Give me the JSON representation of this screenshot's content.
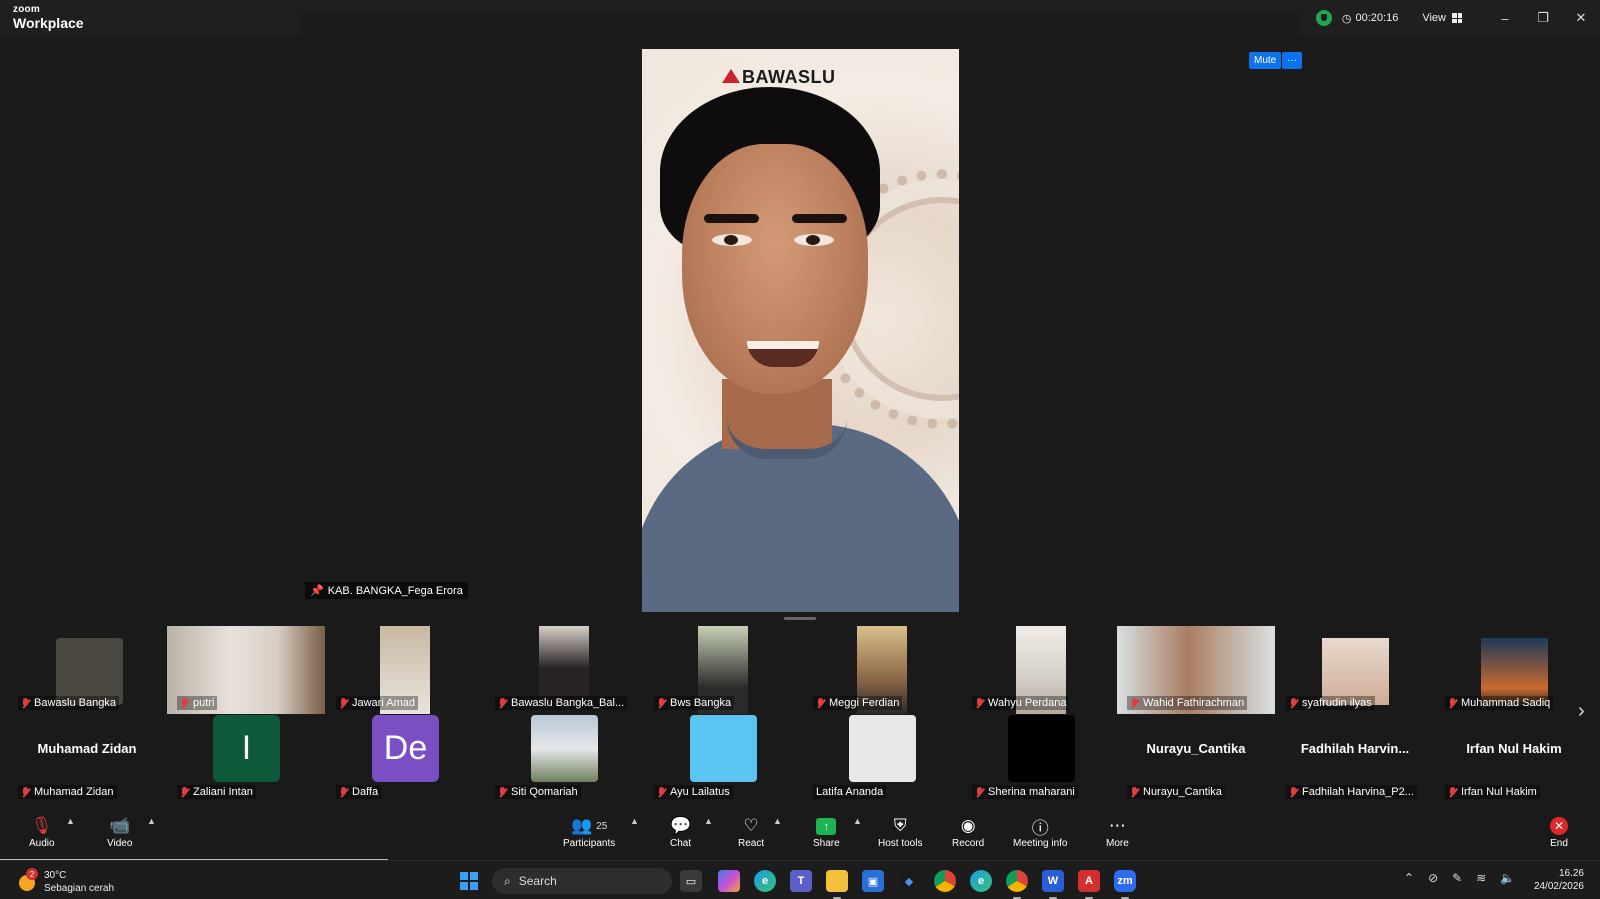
{
  "app": {
    "brand_top": "zoom",
    "brand_bottom": "Workplace"
  },
  "titlebar": {
    "timer": "00:20:16",
    "view_label": "View",
    "minimize": "–",
    "restore": "❐",
    "close": "✕"
  },
  "main": {
    "speaker_name": "KAB. BANGKA_Fega Erora",
    "banner_text": "BAWASLU",
    "mute_label": "Mute",
    "more_label": "···"
  },
  "gallery": {
    "row1": [
      {
        "name": "Bawaslu Bangka"
      },
      {
        "name": "putri"
      },
      {
        "name": "Jawari Amad"
      },
      {
        "name": "Bawaslu Bangka_Bal..."
      },
      {
        "name": "Bws Bangka"
      },
      {
        "name": "Meggi Ferdian"
      },
      {
        "name": "Wahyu Perdana"
      },
      {
        "name": "Wahid Fathirachman"
      },
      {
        "name": "syafrudin ilyas"
      },
      {
        "name": "Muhammad Sadiq"
      }
    ],
    "row2": [
      {
        "name": "Muhamad Zidan",
        "display": "Muhamad Zidan"
      },
      {
        "name": "Zaliani Intan",
        "avatar": "I"
      },
      {
        "name": "Daffa",
        "avatar": "De"
      },
      {
        "name": "Siti Qomariah"
      },
      {
        "name": "Ayu Lailatus"
      },
      {
        "name": "Latifa Ananda"
      },
      {
        "name": "Sherina maharani"
      },
      {
        "name": "Nurayu_Cantika",
        "display": "Nurayu_Cantika"
      },
      {
        "name": "Fadhilah Harvina_P2...",
        "display": "Fadhilah  Harvin..."
      },
      {
        "name": "Irfan Nul Hakim",
        "display": "Irfan Nul Hakim"
      }
    ],
    "next_arrow": "›"
  },
  "toolbar": {
    "audio": "Audio",
    "video": "Video",
    "participants": "Participants",
    "participants_count": "25",
    "chat": "Chat",
    "react": "React",
    "share": "Share",
    "host_tools": "Host tools",
    "record": "Record",
    "meeting_info": "Meeting info",
    "more": "More",
    "end": "End"
  },
  "taskbar": {
    "weather_temp": "30°C",
    "weather_desc": "Sebagian cerah",
    "weather_badge": "2",
    "search_placeholder": "Search",
    "time": "16.26",
    "date": "24/02/2026"
  },
  "colors": {
    "accent_blue": "#0e72ed",
    "share_green": "#1cb351",
    "end_red": "#e02828",
    "mic_off_red": "#e03e3e"
  }
}
